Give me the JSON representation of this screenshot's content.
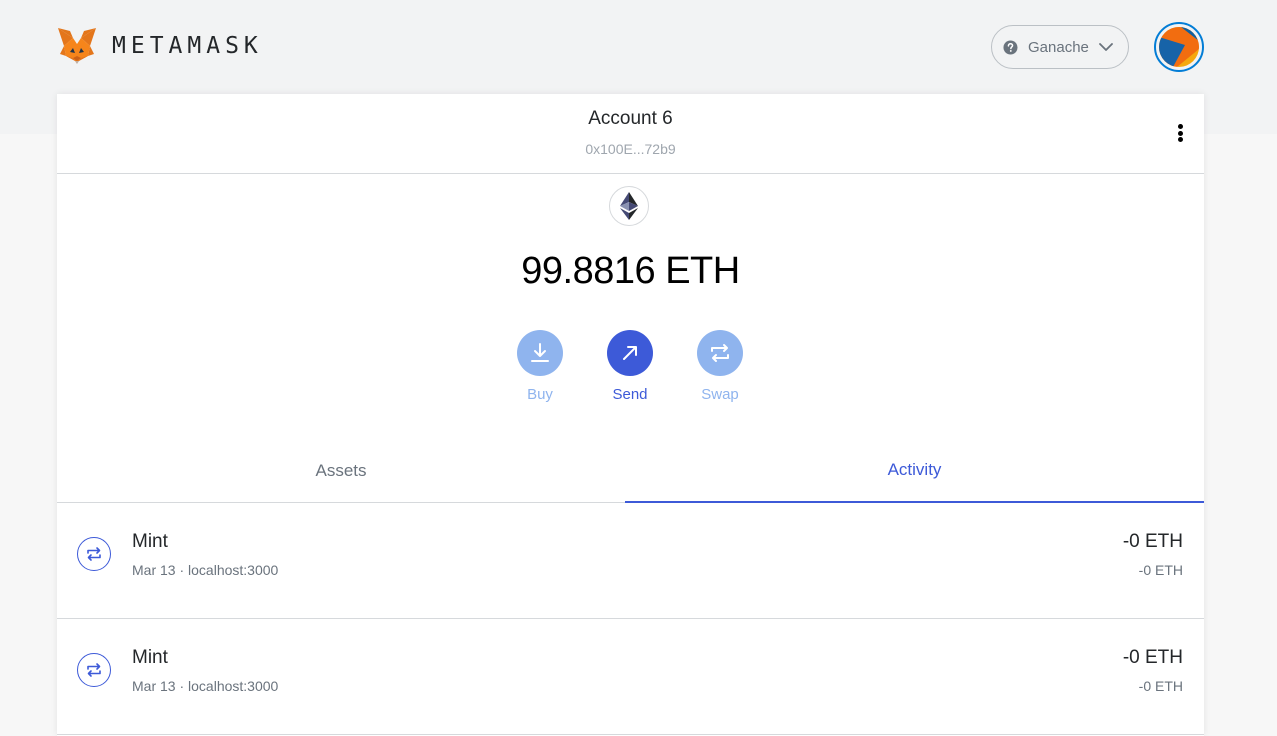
{
  "header": {
    "wordmark": "METAMASK",
    "network_label": "Ganache"
  },
  "account": {
    "name": "Account 6",
    "address": "0x100E...72b9"
  },
  "balance": {
    "text": "99.8816 ETH"
  },
  "actions": [
    {
      "label": "Buy"
    },
    {
      "label": "Send"
    },
    {
      "label": "Swap"
    }
  ],
  "tabs": [
    {
      "label": "Assets"
    },
    {
      "label": "Activity"
    }
  ],
  "activity": [
    {
      "title": "Mint",
      "date": "Mar 13",
      "origin": "localhost:3000",
      "amount": "-0 ETH",
      "amount_secondary": "-0 ETH"
    },
    {
      "title": "Mint",
      "date": "Mar 13",
      "origin": "localhost:3000",
      "amount": "-0 ETH",
      "amount_secondary": "-0 ETH"
    }
  ],
  "colors": {
    "accent": "#3d5ad8",
    "accent_light": "#8fb4ee",
    "text_muted": "#6a737d"
  }
}
